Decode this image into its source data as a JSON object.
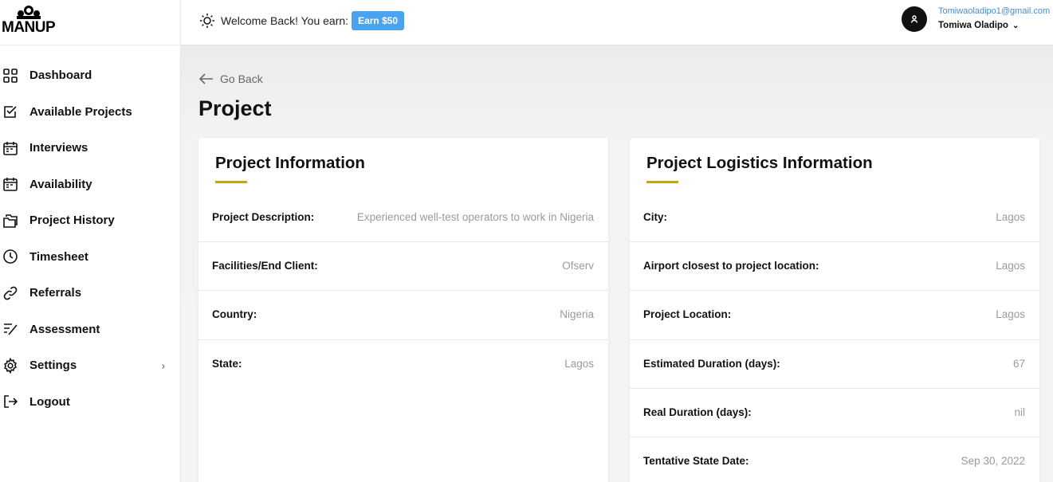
{
  "brand": {
    "name": "MANUP"
  },
  "topbar": {
    "welcome_text": "Welcome Back! You earn:",
    "earn_badge": "Earn $50",
    "user_email": "Tomiwaoladipo1@gmail.com",
    "user_name": "Tomiwa Oladipo"
  },
  "sidebar": {
    "items": [
      {
        "label": "Dashboard",
        "icon": "grid-icon"
      },
      {
        "label": "Available Projects",
        "icon": "checkbox-icon"
      },
      {
        "label": "Interviews",
        "icon": "calendar-icon"
      },
      {
        "label": "Availability",
        "icon": "calendar-icon"
      },
      {
        "label": "Project History",
        "icon": "folders-icon"
      },
      {
        "label": "Timesheet",
        "icon": "clock-icon"
      },
      {
        "label": "Referrals",
        "icon": "link-icon"
      },
      {
        "label": "Assessment",
        "icon": "checklist-icon"
      },
      {
        "label": "Settings",
        "icon": "gear-icon"
      },
      {
        "label": "Logout",
        "icon": "logout-icon"
      }
    ]
  },
  "main": {
    "go_back": "Go Back",
    "title": "Project",
    "project_info": {
      "title": "Project Information",
      "rows": [
        {
          "label": "Project Description:",
          "value": "Experienced well-test operators to work in Nigeria"
        },
        {
          "label": "Facilities/End Client:",
          "value": "Ofserv"
        },
        {
          "label": "Country:",
          "value": "Nigeria"
        },
        {
          "label": "State:",
          "value": "Lagos"
        }
      ]
    },
    "logistics_info": {
      "title": "Project Logistics Information",
      "rows": [
        {
          "label": "City:",
          "value": "Lagos"
        },
        {
          "label": "Airport closest to project location:",
          "value": "Lagos"
        },
        {
          "label": "Project Location:",
          "value": "Lagos"
        },
        {
          "label": "Estimated Duration (days):",
          "value": "67"
        },
        {
          "label": "Real Duration (days):",
          "value": "nil"
        },
        {
          "label": "Tentative State Date:",
          "value": "Sep 30, 2022"
        }
      ]
    }
  },
  "colors": {
    "accent_underline": "#c9a30a",
    "earn_badge_bg": "#4aa3f0",
    "email_link": "#3d8fdc"
  }
}
